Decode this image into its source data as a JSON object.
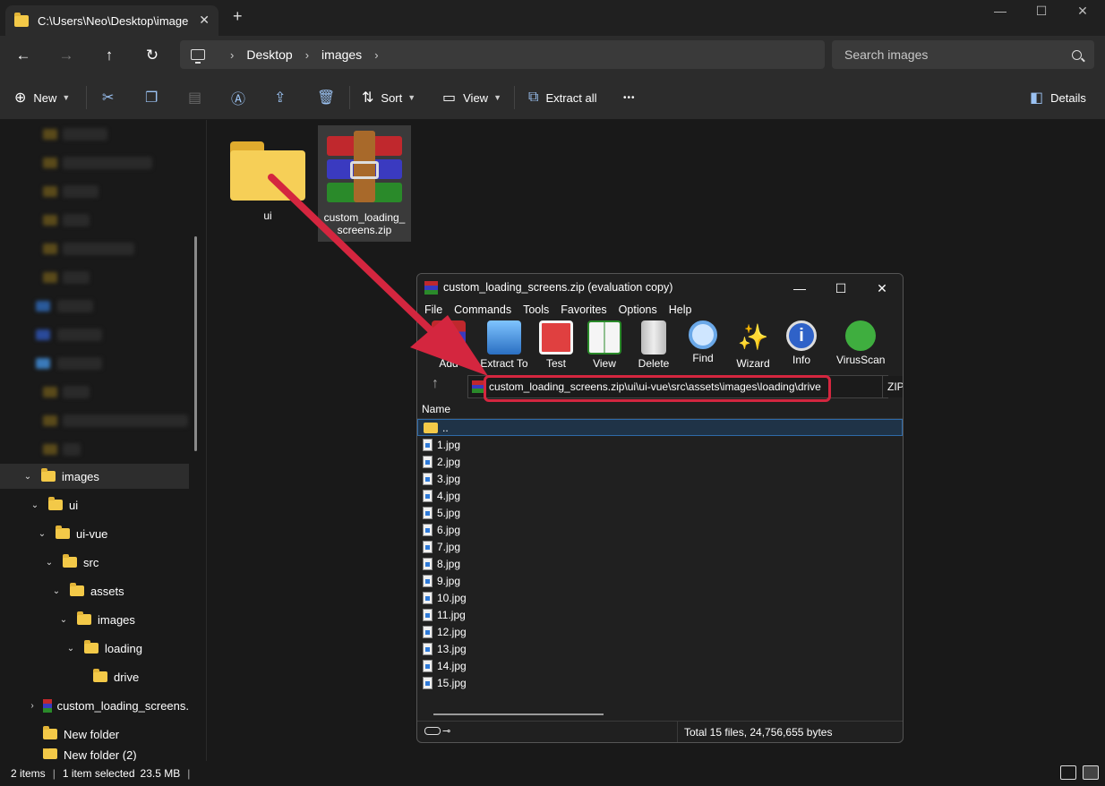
{
  "tab": {
    "title": "C:\\Users\\Neo\\Desktop\\image",
    "close": "✕",
    "new": "+"
  },
  "window_controls": {
    "minimize": "—",
    "maximize": "☐",
    "close": "✕"
  },
  "nav": {
    "back": "←",
    "forward": "→",
    "up": "↑",
    "refresh": "↻"
  },
  "address": {
    "crumbs": [
      "Desktop",
      "images"
    ],
    "separator": "›"
  },
  "search": {
    "placeholder": "Search images"
  },
  "commands": {
    "new": "New",
    "sort": "Sort",
    "view": "View",
    "extract_all": "Extract all",
    "more": "•••",
    "details": "Details"
  },
  "sidebar": {
    "items": [
      {
        "label": "images",
        "expanded": true
      },
      {
        "label": "ui",
        "expanded": true
      },
      {
        "label": "ui-vue",
        "expanded": true
      },
      {
        "label": "src",
        "expanded": true
      },
      {
        "label": "assets",
        "expanded": true
      },
      {
        "label": "images",
        "expanded": true
      },
      {
        "label": "loading",
        "expanded": true
      },
      {
        "label": "drive",
        "expanded": false
      },
      {
        "label": "custom_loading_screens.",
        "expanded": false
      },
      {
        "label": "New folder",
        "expanded": false
      },
      {
        "label": "New folder (2)",
        "expanded": false
      }
    ]
  },
  "content": {
    "files": [
      {
        "name": "ui",
        "type": "folder"
      },
      {
        "name": "custom_loading_screens.zip",
        "name_line1": "custom_loading_",
        "name_line2": "screens.zip",
        "type": "zip",
        "selected": true
      }
    ]
  },
  "winrar": {
    "title": "custom_loading_screens.zip (evaluation copy)",
    "menu": [
      "File",
      "Commands",
      "Tools",
      "Favorites",
      "Options",
      "Help"
    ],
    "toolbar": [
      "Add",
      "Extract To",
      "Test",
      "View",
      "Delete",
      "Find",
      "Wizard",
      "Info",
      "VirusScan"
    ],
    "path": "custom_loading_screens.zip\\ui\\ui-vue\\src\\assets\\images\\loading\\drive",
    "type": "ZIP archive",
    "column_name": "Name",
    "up_label": "..",
    "files": [
      "1.jpg",
      "2.jpg",
      "3.jpg",
      "4.jpg",
      "5.jpg",
      "6.jpg",
      "7.jpg",
      "8.jpg",
      "9.jpg",
      "10.jpg",
      "11.jpg",
      "12.jpg",
      "13.jpg",
      "14.jpg",
      "15.jpg"
    ],
    "status": "Total 15 files, 24,756,655 bytes"
  },
  "statusbar": {
    "items": "2 items",
    "selected": "1 item selected",
    "size": "23.5 MB"
  },
  "colors": {
    "accent": "#d4263f",
    "folder": "#f3c948",
    "background": "#191919"
  }
}
